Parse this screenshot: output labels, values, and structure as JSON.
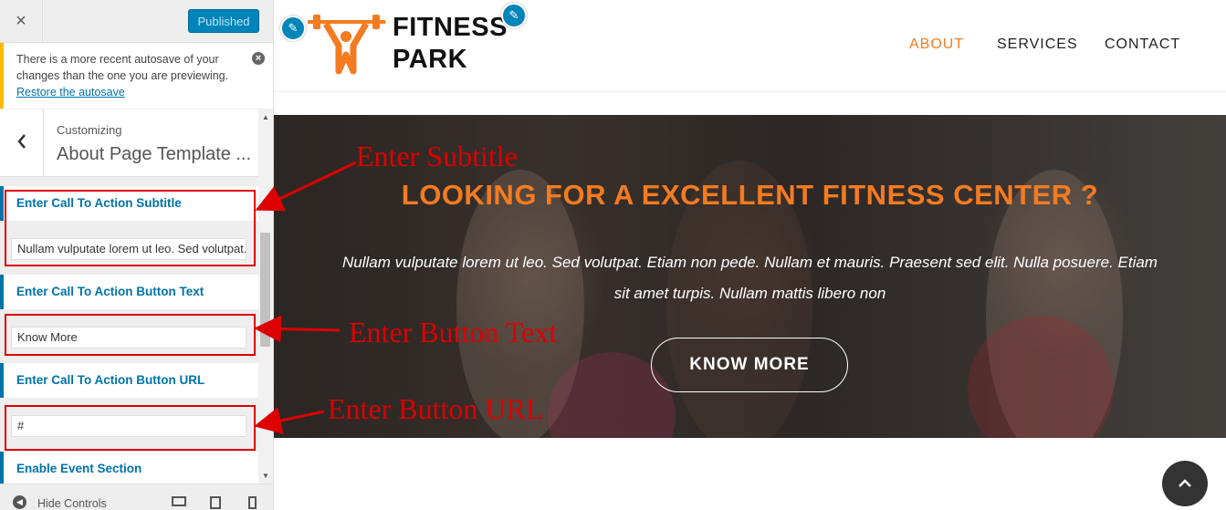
{
  "sidebar": {
    "close_icon": "×",
    "publish_label": "Published",
    "notice": {
      "text": "There is a more recent autosave of your changes than the one you are previewing.",
      "link": "Restore the autosave"
    },
    "panel": {
      "back_icon": "‹",
      "breadcrumb": "Customizing",
      "title": "About Page Template ..."
    },
    "fields": [
      {
        "label": "Enter Call To Action Subtitle",
        "value": "Nullam vulputate lorem ut leo. Sed volutpat."
      },
      {
        "label": "Enter Call To Action Button Text",
        "value": "Know More"
      },
      {
        "label": "Enter Call To Action Button URL",
        "value": "#"
      }
    ],
    "next_section": "Enable Event Section",
    "footer": {
      "hide_label": "Hide Controls"
    }
  },
  "annotations": {
    "subtitle": "Enter Subtitle",
    "button_text": "Enter Button Text",
    "button_url": "Enter Button URL"
  },
  "site": {
    "logo_line1": "FITNESS",
    "logo_line2": "PARK",
    "nav": [
      "ABOUT",
      "SERVICES",
      "CONTACT"
    ],
    "nav_active_color": "#f47b20"
  },
  "hero": {
    "title": "LOOKING FOR A EXCELLENT FITNESS CENTER ?",
    "text": "Nullam vulputate lorem ut leo. Sed volutpat. Etiam non pede. Nullam et mauris. Praesent sed elit. Nulla posuere. Etiam sit amet turpis. Nullam mattis libero non",
    "button": "KNOW MORE"
  },
  "colors": {
    "accent": "#f47b20",
    "wp_blue": "#0085ba",
    "annotation_red": "#dd0000"
  }
}
